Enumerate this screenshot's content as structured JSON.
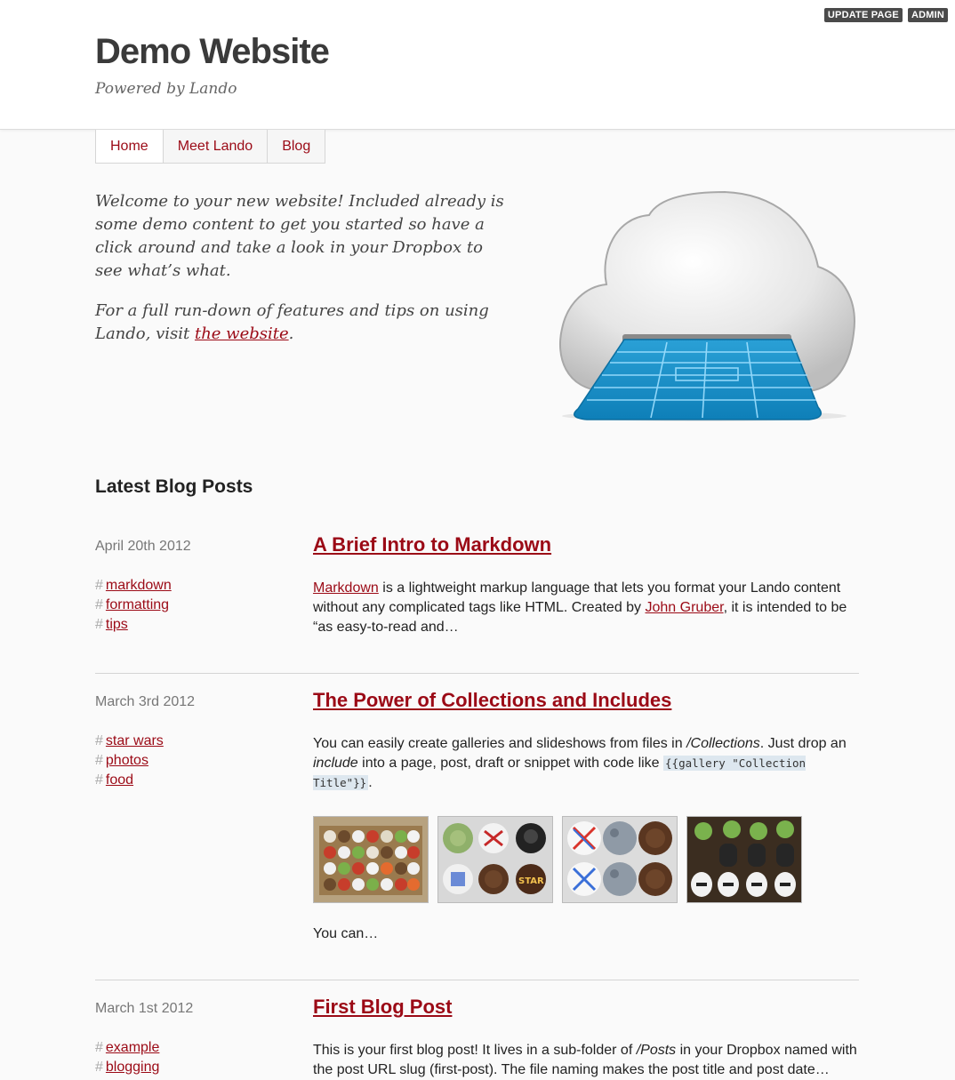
{
  "admin": {
    "update_label": "UPDATE PAGE",
    "admin_label": "ADMIN"
  },
  "header": {
    "title": "Demo Website",
    "tagline": "Powered by Lando"
  },
  "nav": {
    "items": [
      "Home",
      "Meet Lando",
      "Blog"
    ],
    "active": "Home"
  },
  "intro": {
    "p1": "Welcome to your new website! Included already is some demo content to get you started so have a click around and take a look in your Dropbox to see what’s what.",
    "p2_before": "For a full run-down of features and tips on using Lando, visit ",
    "p2_link": "the website",
    "p2_after": "."
  },
  "latest": {
    "title": "Latest Blog Posts"
  },
  "posts": [
    {
      "date": "April 20th 2012",
      "title": "A Brief Intro to Markdown",
      "tags": [
        "markdown",
        "formatting",
        "tips"
      ],
      "body": {
        "link1": "Markdown",
        "text1": " is a lightweight markup language that lets you format your Lando content without any complicated tags like HTML. Created by ",
        "link2": "John Gruber",
        "text2": ", it is intended to be “as easy-to-read and…"
      }
    },
    {
      "date": "March 3rd 2012",
      "title": "The Power of Collections and Includes",
      "tags": [
        "star wars",
        "photos",
        "food"
      ],
      "body": {
        "text1": "You can easily create galleries and slideshows from files in ",
        "em1": "/Collections",
        "text2": ". Just drop an ",
        "em2": "include",
        "text3": " into a page, post, draft or snippet with code like ",
        "code": "{{gallery \"Collection Title\"}}",
        "text4": ".",
        "more": "You can…"
      },
      "gallery": [
        "cupcakes-box-image",
        "starwars-cupcakes-image",
        "deathstar-cookies-image",
        "stormtrooper-cookies-image"
      ]
    },
    {
      "date": "March 1st 2012",
      "title": "First Blog Post",
      "tags": [
        "example",
        "blogging"
      ],
      "body": {
        "text1": "This is your first blog post! It lives in a sub-folder of ",
        "em1": "/Posts",
        "text2": " in your Dropbox named with the post URL slug (first-post). The file naming makes the post title and post date…"
      }
    }
  ]
}
